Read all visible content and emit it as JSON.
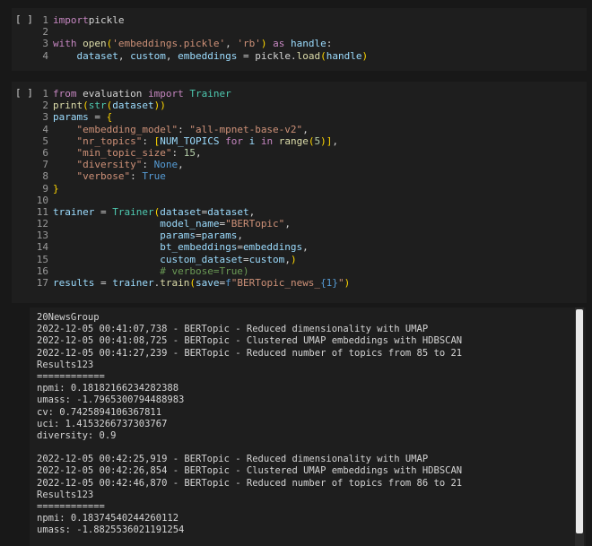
{
  "cells": [
    {
      "run_label": "[ ]",
      "lines": [
        {
          "n": "1",
          "tokens": [
            [
              "kw",
              "import"
            ],
            [
              "",
              "pickle"
            ]
          ]
        },
        {
          "n": "2",
          "tokens": []
        },
        {
          "n": "3",
          "tokens": [
            [
              "kw",
              "with"
            ],
            [
              "",
              " "
            ],
            [
              "fn",
              "open"
            ],
            [
              "br",
              "("
            ],
            [
              "str",
              "'embeddings.pickle'"
            ],
            [
              "",
              ", "
            ],
            [
              "str",
              "'rb'"
            ],
            [
              "br",
              ")"
            ],
            [
              "",
              " "
            ],
            [
              "kw",
              "as"
            ],
            [
              "",
              ""
            ],
            [
              "var",
              " handle"
            ],
            [
              "",
              ":"
            ]
          ]
        },
        {
          "n": "4",
          "tokens": [
            [
              "",
              "    "
            ],
            [
              "var",
              "dataset"
            ],
            [
              "",
              ", "
            ],
            [
              "var",
              "custom"
            ],
            [
              "",
              ", "
            ],
            [
              "var",
              "embeddings"
            ],
            [
              "",
              " = "
            ],
            [
              "",
              "pickle"
            ],
            [
              "",
              "."
            ],
            [
              "fn",
              "load"
            ],
            [
              "br",
              "("
            ],
            [
              "var",
              "handle"
            ],
            [
              "br",
              ")"
            ]
          ]
        }
      ]
    },
    {
      "run_label": "[ ]",
      "lines": [
        {
          "n": "1",
          "tokens": [
            [
              "kw",
              "from"
            ],
            [
              "",
              " evaluation "
            ],
            [
              "kw",
              "import"
            ],
            [
              "",
              " "
            ],
            [
              "cls",
              "Trainer"
            ]
          ]
        },
        {
          "n": "2",
          "tokens": [
            [
              "fn",
              "print"
            ],
            [
              "br",
              "("
            ],
            [
              "cls",
              "str"
            ],
            [
              "br",
              "("
            ],
            [
              "var",
              "dataset"
            ],
            [
              "br",
              "))"
            ]
          ]
        },
        {
          "n": "3",
          "tokens": [
            [
              "var",
              "params"
            ],
            [
              "",
              " = "
            ],
            [
              "br",
              "{"
            ]
          ]
        },
        {
          "n": "4",
          "tokens": [
            [
              "",
              "    "
            ],
            [
              "str",
              "\"embedding_model\""
            ],
            [
              "",
              ": "
            ],
            [
              "str",
              "\"all-mpnet-base-v2\""
            ],
            [
              "",
              ","
            ]
          ]
        },
        {
          "n": "5",
          "tokens": [
            [
              "",
              "    "
            ],
            [
              "str",
              "\"nr_topics\""
            ],
            [
              "",
              ": "
            ],
            [
              "br",
              "["
            ],
            [
              "var",
              "NUM_TOPICS"
            ],
            [
              "",
              " "
            ],
            [
              "kw",
              "for"
            ],
            [
              "",
              " "
            ],
            [
              "var",
              "i"
            ],
            [
              "",
              " "
            ],
            [
              "kw",
              "in"
            ],
            [
              "",
              " "
            ],
            [
              "fn",
              "range"
            ],
            [
              "br",
              "("
            ],
            [
              "num",
              "5"
            ],
            [
              "br",
              ")]"
            ],
            [
              "",
              ","
            ]
          ]
        },
        {
          "n": "6",
          "tokens": [
            [
              "",
              "    "
            ],
            [
              "str",
              "\"min_topic_size\""
            ],
            [
              "",
              ": "
            ],
            [
              "num",
              "15"
            ],
            [
              "",
              ","
            ]
          ]
        },
        {
          "n": "7",
          "tokens": [
            [
              "",
              "    "
            ],
            [
              "str",
              "\"diversity\""
            ],
            [
              "",
              ": "
            ],
            [
              "kb",
              "None"
            ],
            [
              "",
              ","
            ]
          ]
        },
        {
          "n": "8",
          "tokens": [
            [
              "",
              "    "
            ],
            [
              "str",
              "\"verbose\""
            ],
            [
              "",
              ": "
            ],
            [
              "kb",
              "True"
            ]
          ]
        },
        {
          "n": "9",
          "tokens": [
            [
              "br",
              "}"
            ]
          ]
        },
        {
          "n": "10",
          "tokens": []
        },
        {
          "n": "11",
          "tokens": [
            [
              "var",
              "trainer"
            ],
            [
              "",
              " = "
            ],
            [
              "cls",
              "Trainer"
            ],
            [
              "br",
              "("
            ],
            [
              "var",
              "dataset"
            ],
            [
              "",
              "="
            ],
            [
              "var",
              "dataset"
            ],
            [
              "",
              ","
            ]
          ]
        },
        {
          "n": "12",
          "tokens": [
            [
              "",
              "                  "
            ],
            [
              "var",
              "model_name"
            ],
            [
              "",
              "="
            ],
            [
              "str",
              "\"BERTopic\""
            ],
            [
              "",
              ","
            ]
          ]
        },
        {
          "n": "13",
          "tokens": [
            [
              "",
              "                  "
            ],
            [
              "var",
              "params"
            ],
            [
              "",
              "="
            ],
            [
              "var",
              "params"
            ],
            [
              "",
              ","
            ]
          ]
        },
        {
          "n": "14",
          "tokens": [
            [
              "",
              "                  "
            ],
            [
              "var",
              "bt_embeddings"
            ],
            [
              "",
              "="
            ],
            [
              "var",
              "embeddings"
            ],
            [
              "",
              ","
            ]
          ]
        },
        {
          "n": "15",
          "tokens": [
            [
              "",
              "                  "
            ],
            [
              "var",
              "custom_dataset"
            ],
            [
              "",
              "="
            ],
            [
              "var",
              "custom"
            ],
            [
              "",
              ","
            ],
            [
              "br",
              ")"
            ]
          ]
        },
        {
          "n": "16",
          "tokens": [
            [
              "",
              "                  "
            ],
            [
              "cmt",
              "# verbose=True)"
            ]
          ]
        },
        {
          "n": "17",
          "tokens": [
            [
              "var",
              "results"
            ],
            [
              "",
              " = "
            ],
            [
              "var",
              "trainer"
            ],
            [
              "",
              "."
            ],
            [
              "fn",
              "train"
            ],
            [
              "br",
              "("
            ],
            [
              "var",
              "save"
            ],
            [
              "",
              "="
            ],
            [
              "kb",
              "f"
            ],
            [
              "str",
              "\"BERTopic_news_"
            ],
            [
              "kb",
              "{1}"
            ],
            [
              "str",
              "\""
            ],
            [
              "br",
              ")"
            ]
          ]
        }
      ]
    }
  ],
  "output": {
    "lines": [
      "20NewsGroup",
      "2022-12-05 00:41:07,738 - BERTopic - Reduced dimensionality with UMAP",
      "2022-12-05 00:41:08,725 - BERTopic - Clustered UMAP embeddings with HDBSCAN",
      "2022-12-05 00:41:27,239 - BERTopic - Reduced number of topics from 85 to 21",
      "Results123",
      "============",
      "npmi: 0.18182166234282388",
      "umass: -1.7965300794488983",
      "cv: 0.7425894106367811",
      "uci: 1.4153266737303767",
      "diversity: 0.9",
      "",
      "2022-12-05 00:42:25,919 - BERTopic - Reduced dimensionality with UMAP",
      "2022-12-05 00:42:26,854 - BERTopic - Clustered UMAP embeddings with HDBSCAN",
      "2022-12-05 00:42:46,870 - BERTopic - Reduced number of topics from 86 to 21",
      "Results123",
      "============",
      "npmi: 0.18374540244260112",
      "umass: -1.8825536021191254"
    ]
  }
}
